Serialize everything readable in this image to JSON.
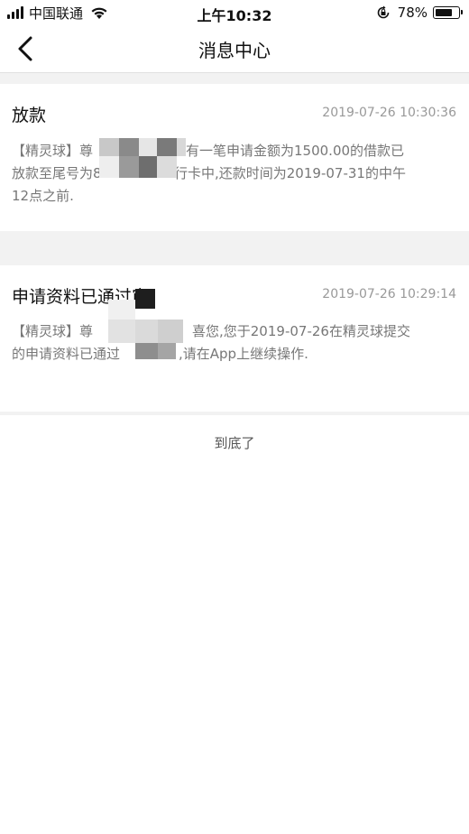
{
  "status_bar": {
    "carrier": "中国联通",
    "time": "上午10:32",
    "battery_percent": "78%",
    "battery_level": 0.78,
    "icons": [
      "signal-icon",
      "wifi-icon",
      "orientation-lock-icon",
      "battery-icon"
    ]
  },
  "nav": {
    "title": "消息中心",
    "back_icon": "chevron-left-icon"
  },
  "messages": [
    {
      "title": "放款",
      "time": "2019-07-26 10:30:36",
      "body_line1": "【精灵球】尊",
      "body_line1_end": "有一笔申请金额为1500.00的借款已",
      "body_line2": "放款至尾号为8",
      "body_line2_end": "行卡中,还款时间为2019-07-31的中午",
      "body_line3": "12点之前."
    },
    {
      "title": "申请资料已通过审",
      "time": "2019-07-26 10:29:14",
      "body_line1": "【精灵球】尊",
      "body_line1_end": "喜您,您于2019-07-26在精灵球提交",
      "body_line2": "的申请资料已通过",
      "body_line2_end": ",请在App上继续操作."
    }
  ],
  "footer": {
    "end_text": "到底了"
  },
  "colors": {
    "background": "#ffffff",
    "separator": "#f2f2f2",
    "title_text": "#111111",
    "body_text": "#777777",
    "time_text": "#999999"
  }
}
